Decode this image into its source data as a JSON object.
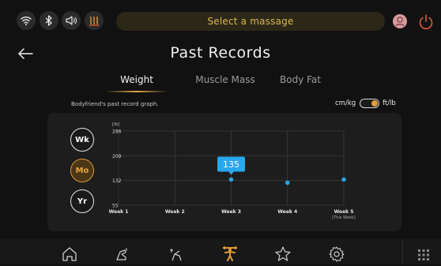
{
  "header": {
    "select_label": "Select a massage",
    "status_icons": [
      "wifi-icon",
      "bluetooth-icon",
      "speaker-icon",
      "heat-icon"
    ],
    "avatar_icon": "avatar-icon",
    "power_icon": "power-icon",
    "accent": "#d9b64a"
  },
  "title": {
    "back_icon": "back-arrow-icon",
    "text": "Past Records"
  },
  "tabs": [
    {
      "label": "Weight",
      "active": true
    },
    {
      "label": "Muscle Mass",
      "active": false
    },
    {
      "label": "Body Fat",
      "active": false
    }
  ],
  "graph": {
    "caption": "Bodyfriend's past record graph.",
    "unit_left": "cm/kg",
    "unit_right": "ft/lb",
    "unit_toggle_on": true
  },
  "period_buttons": [
    {
      "label": "Wk",
      "active": false
    },
    {
      "label": "Mo",
      "active": true
    },
    {
      "label": "Yr",
      "active": false
    }
  ],
  "chart_data": {
    "type": "scatter",
    "y_unit_label": "[lb]",
    "y_ticks": [
      "286",
      "209",
      "132",
      "55"
    ],
    "ylim": [
      55,
      286
    ],
    "categories": [
      "Week 1",
      "Week 2",
      "Week 3",
      "Week 4",
      "Week 5"
    ],
    "category_sublabel": {
      "index": 4,
      "text": "[This Week]"
    },
    "points": [
      {
        "category_index": 2,
        "value": 135
      },
      {
        "category_index": 3,
        "value": 125
      },
      {
        "category_index": 4,
        "value": 135
      }
    ],
    "highlight": {
      "point_index": 0,
      "label": "135"
    },
    "grid": true,
    "accent": "#2aa3e8"
  },
  "bottom_nav": [
    {
      "icon": "home-icon",
      "active": false
    },
    {
      "icon": "massage-chair-icon",
      "active": false
    },
    {
      "icon": "stretch-icon",
      "active": false
    },
    {
      "icon": "body-records-icon",
      "active": true
    },
    {
      "icon": "favorites-star-icon",
      "active": false
    },
    {
      "icon": "settings-gear-icon",
      "active": false
    }
  ],
  "menu_icon": "app-grid-icon"
}
